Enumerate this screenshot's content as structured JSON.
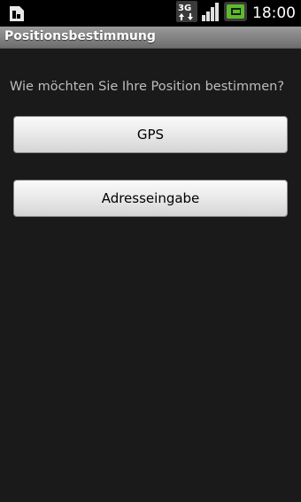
{
  "status_bar": {
    "time": "18:00",
    "network_type": "3G",
    "icons": [
      "sim-card-icon",
      "network-3g-icon",
      "signal-strength-icon",
      "battery-icon"
    ],
    "battery_color": "#5dbb2a"
  },
  "app": {
    "title": "Positionsbestimmung"
  },
  "main": {
    "prompt": "Wie möchten Sie Ihre Position bestimmen?",
    "gps_button": "GPS",
    "address_button": "Adresseingabe"
  }
}
